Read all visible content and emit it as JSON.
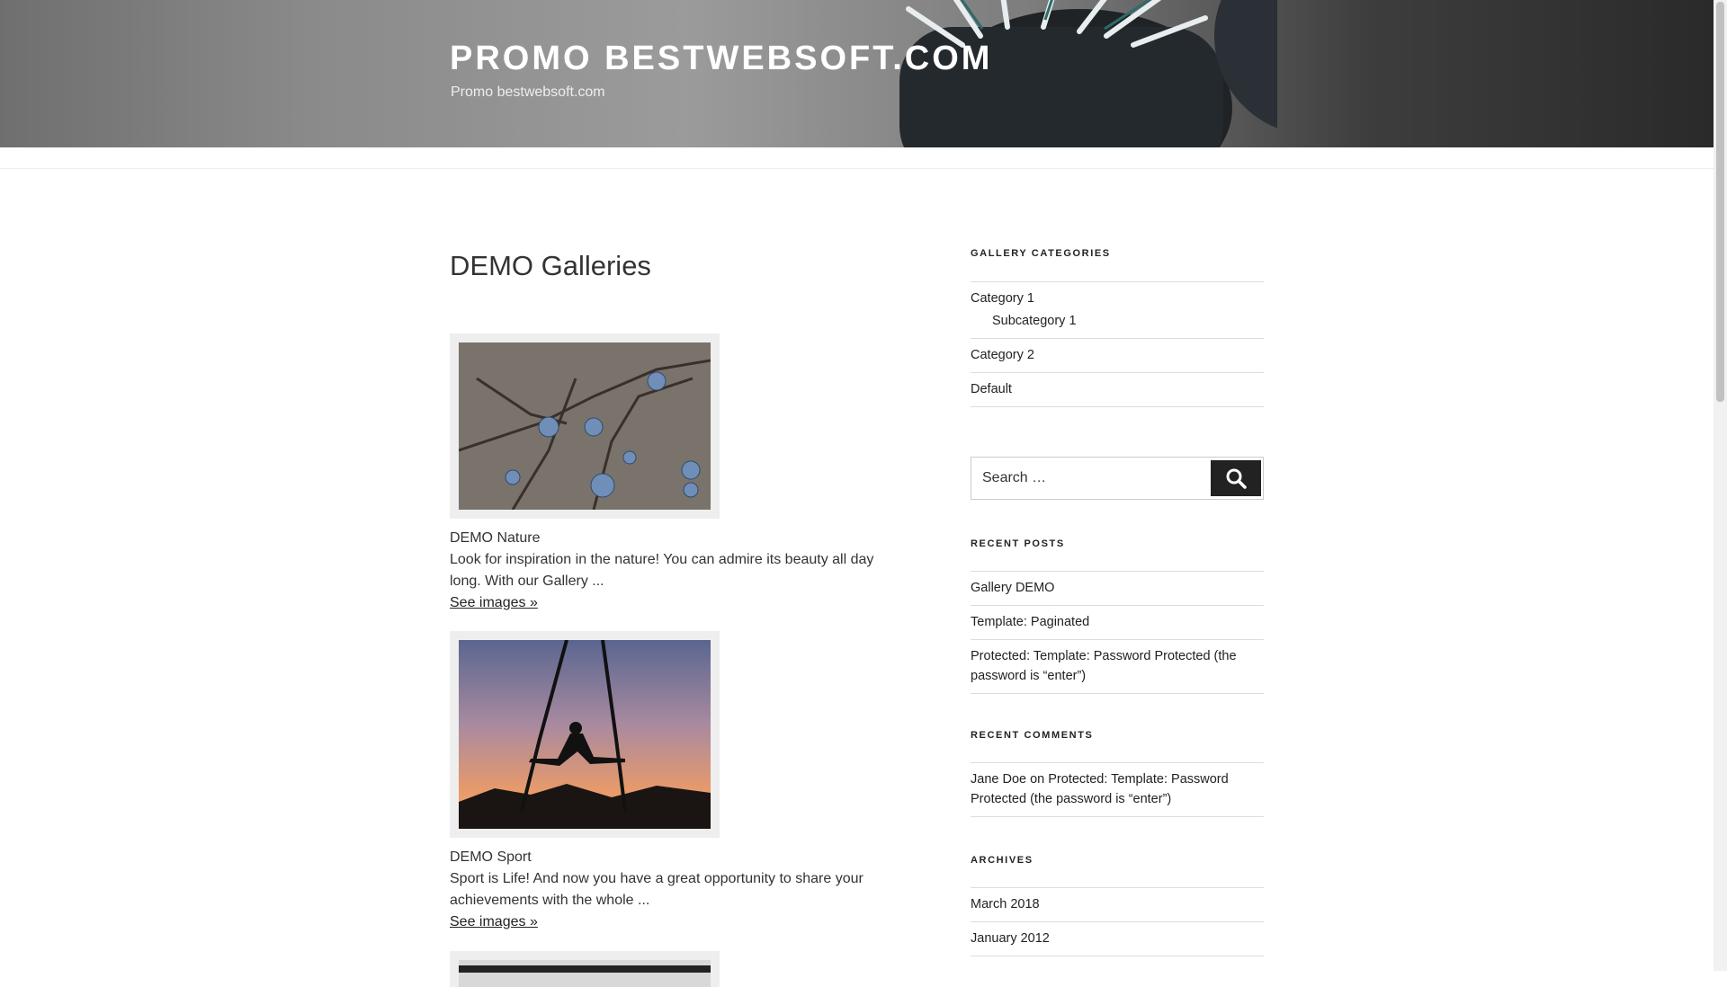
{
  "header": {
    "site_title": "PROMO BESTWEBSOFT.COM",
    "tagline": "Promo bestwebsoft.com"
  },
  "main": {
    "page_title": "DEMO Galleries",
    "galleries": [
      {
        "title": "DEMO Nature",
        "excerpt": "Look for inspiration in the nature! You can admire its beauty all day long. With our Gallery ...",
        "link": "See images »"
      },
      {
        "title": "DEMO Sport",
        "excerpt": "Sport is Life! And now you have a great opportunity to share your achievements with the whole ...",
        "link": "See images »"
      }
    ]
  },
  "sidebar": {
    "gallery_categories": {
      "title": "GALLERY CATEGORIES",
      "items": [
        "Category 1",
        "Subcategory 1",
        "Category 2",
        "Default"
      ]
    },
    "search": {
      "placeholder": "Search …"
    },
    "recent_posts": {
      "title": "RECENT POSTS",
      "items": [
        "Gallery DEMO",
        "Template: Paginated",
        "Protected: Template: Password Protected (the password is “enter”)"
      ]
    },
    "recent_comments": {
      "title": "RECENT COMMENTS",
      "author": "Jane Doe",
      "on": " on ",
      "post": "Protected: Template: Password Protected (the password is “enter”)"
    },
    "archives": {
      "title": "ARCHIVES",
      "items": [
        "March 2018",
        "January 2012"
      ]
    }
  },
  "colors": {
    "text": "#222222",
    "border": "#dddddd",
    "search_button": "#222222",
    "thumb_frame": "#eeeeee"
  },
  "icons": [
    "search-icon"
  ]
}
